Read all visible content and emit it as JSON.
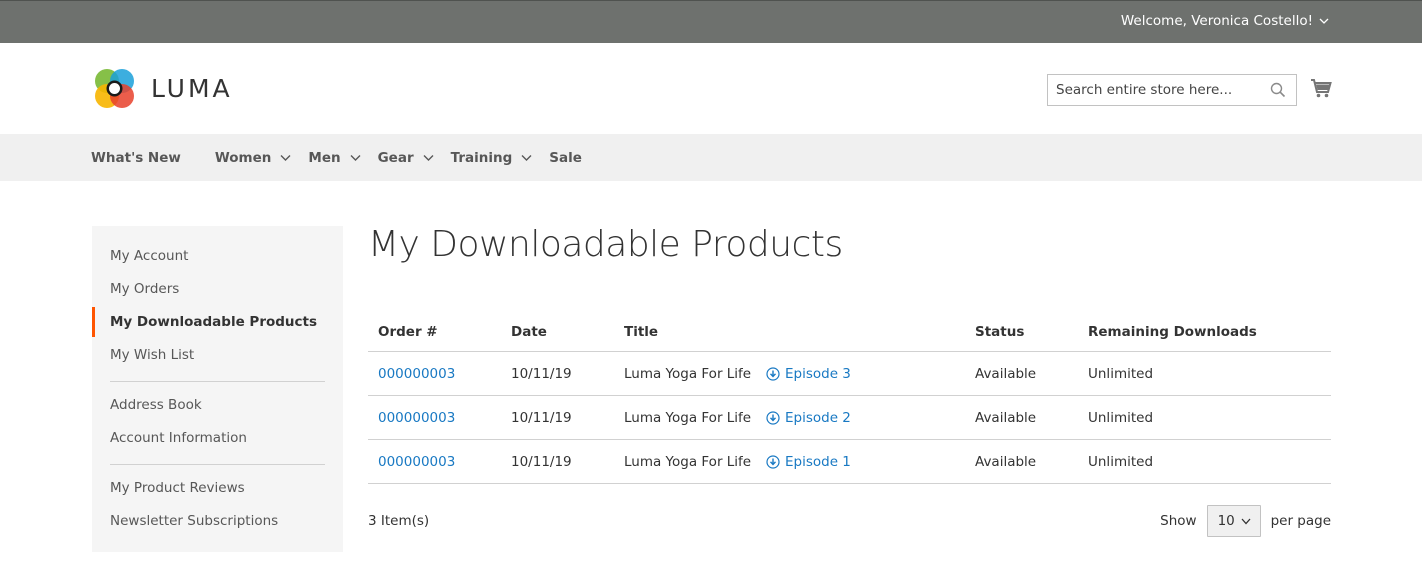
{
  "top_bar": {
    "welcome": "Welcome, Veronica Costello!"
  },
  "header": {
    "logo_text": "LUMA",
    "search_placeholder": "Search entire store here..."
  },
  "nav": {
    "items": [
      {
        "label": "What's New",
        "has_dropdown": false
      },
      {
        "label": "Women",
        "has_dropdown": true
      },
      {
        "label": "Men",
        "has_dropdown": true
      },
      {
        "label": "Gear",
        "has_dropdown": true
      },
      {
        "label": "Training",
        "has_dropdown": true
      },
      {
        "label": "Sale",
        "has_dropdown": false
      }
    ]
  },
  "sidebar": {
    "group1": [
      {
        "label": "My Account"
      },
      {
        "label": "My Orders"
      },
      {
        "label": "My Downloadable Products",
        "active": true
      },
      {
        "label": "My Wish List"
      }
    ],
    "group2": [
      {
        "label": "Address Book"
      },
      {
        "label": "Account Information"
      }
    ],
    "group3": [
      {
        "label": "My Product Reviews"
      },
      {
        "label": "Newsletter Subscriptions"
      }
    ]
  },
  "main": {
    "title": "My Downloadable Products",
    "columns": [
      "Order #",
      "Date",
      "Title",
      "Status",
      "Remaining Downloads"
    ],
    "rows": [
      {
        "order": "000000003",
        "date": "10/11/19",
        "title": "Luma Yoga For Life",
        "link": "Episode 3",
        "status": "Available",
        "remaining": "Unlimited"
      },
      {
        "order": "000000003",
        "date": "10/11/19",
        "title": "Luma Yoga For Life",
        "link": "Episode 2",
        "status": "Available",
        "remaining": "Unlimited"
      },
      {
        "order": "000000003",
        "date": "10/11/19",
        "title": "Luma Yoga For Life",
        "link": "Episode 1",
        "status": "Available",
        "remaining": "Unlimited"
      }
    ],
    "toolbar": {
      "amount": "3 Item(s)",
      "show_label": "Show",
      "per_page_value": "10",
      "per_page_label": "per page"
    }
  },
  "colors": {
    "top_bar": "#6e716e",
    "nav_bg": "#f0f0f0",
    "link": "#1979c3",
    "active_marker": "#ff5501",
    "sidebar_bg": "#f5f5f5"
  },
  "icons": [
    "chevron-down-icon",
    "luma-logo-icon",
    "search-icon",
    "cart-icon",
    "download-icon"
  ]
}
